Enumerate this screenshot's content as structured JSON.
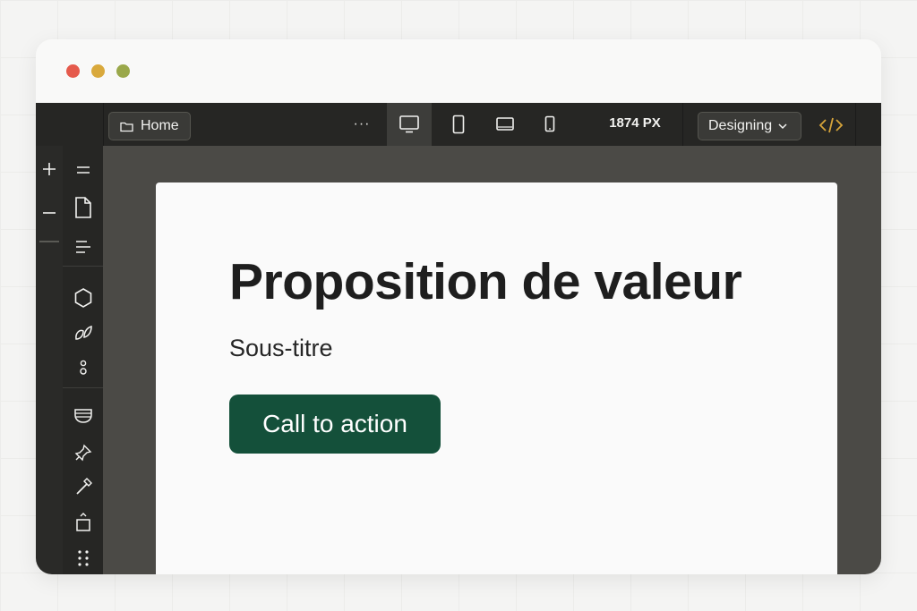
{
  "window": {
    "controls": [
      "close",
      "minimize",
      "maximize"
    ]
  },
  "toolbar": {
    "logo_icon": "wordpress-icon",
    "breadcrumb_label": "Home",
    "more_label": "···",
    "devices": [
      {
        "name": "desktop-icon",
        "active": true
      },
      {
        "name": "tablet-portrait-icon",
        "active": false
      },
      {
        "name": "tablet-landscape-icon",
        "active": false
      },
      {
        "name": "mobile-icon",
        "active": false
      }
    ],
    "width_readout": "1874 PX",
    "mode_label": "Designing",
    "code_icon": "code-icon"
  },
  "rail": {
    "items": [
      "plus-icon",
      "minus-icon"
    ]
  },
  "sidebar": {
    "items": [
      "hamburger-icon",
      "page-icon",
      "text-align-icon",
      "hexagon-icon",
      "leaves-icon",
      "circles-icon",
      "stack-icon",
      "pin-icon",
      "hammer-icon",
      "box-icon",
      "grid-dots-icon"
    ]
  },
  "canvas": {
    "title": "Proposition de valeur",
    "subtitle": "Sous-titre",
    "cta_label": "Call to action"
  },
  "colors": {
    "dark_chrome": "#262624",
    "canvas_bg": "#4b4a46",
    "cta_bg": "#14503a",
    "code_icon_color": "#d6a43a"
  }
}
